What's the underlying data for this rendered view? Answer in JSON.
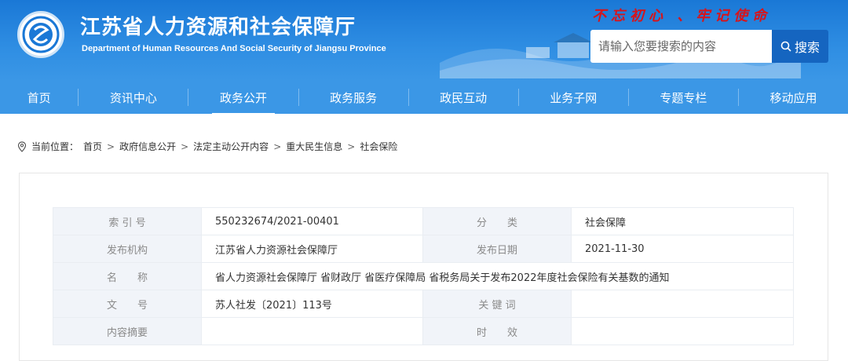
{
  "site": {
    "title": "江苏省人力资源和社会保障厅",
    "subtitle": "Department of Human Resources And Social Security of Jiangsu Province",
    "slogan": "不忘初心 、牢记使命",
    "logo_icon": "jiangsu-hrss-emblem-icon"
  },
  "search": {
    "placeholder": "请输入您要搜索的内容",
    "button_label": "搜索",
    "icon": "search-icon"
  },
  "nav": {
    "items": [
      {
        "label": "首页"
      },
      {
        "label": "资讯中心"
      },
      {
        "label": "政务公开",
        "active": true
      },
      {
        "label": "政务服务"
      },
      {
        "label": "政民互动"
      },
      {
        "label": "业务子网"
      },
      {
        "label": "专题专栏"
      },
      {
        "label": "移动应用"
      }
    ]
  },
  "breadcrumb": {
    "prefix": "当前位置：",
    "items": [
      "首页",
      "政府信息公开",
      "法定主动公开内容",
      "重大民生信息",
      "社会保险"
    ],
    "separator": ">"
  },
  "meta_table": {
    "rows": [
      {
        "label1": "索 引 号",
        "value1": "550232674/2021-00401",
        "label2": "分　　类",
        "value2": "社会保障"
      },
      {
        "label1": "发布机构",
        "value1": "江苏省人力资源社会保障厅",
        "label2": "发布日期",
        "value2": "2021-11-30"
      },
      {
        "label1": "名　　称",
        "value1": "省人力资源社会保障厅 省财政厅 省医疗保障局 省税务局关于发布2022年度社会保险有关基数的通知"
      },
      {
        "label1": "文　　号",
        "value1": "苏人社发〔2021〕113号",
        "label2": "关 键 词",
        "value2": ""
      },
      {
        "label1": "内容摘要",
        "value1": "",
        "label2": "时　　效",
        "value2": ""
      }
    ]
  },
  "colors": {
    "header_blue": "#2f8ee3",
    "nav_blue": "#3b97e6",
    "search_button": "#1565c0",
    "slogan_red": "#d7141a"
  }
}
